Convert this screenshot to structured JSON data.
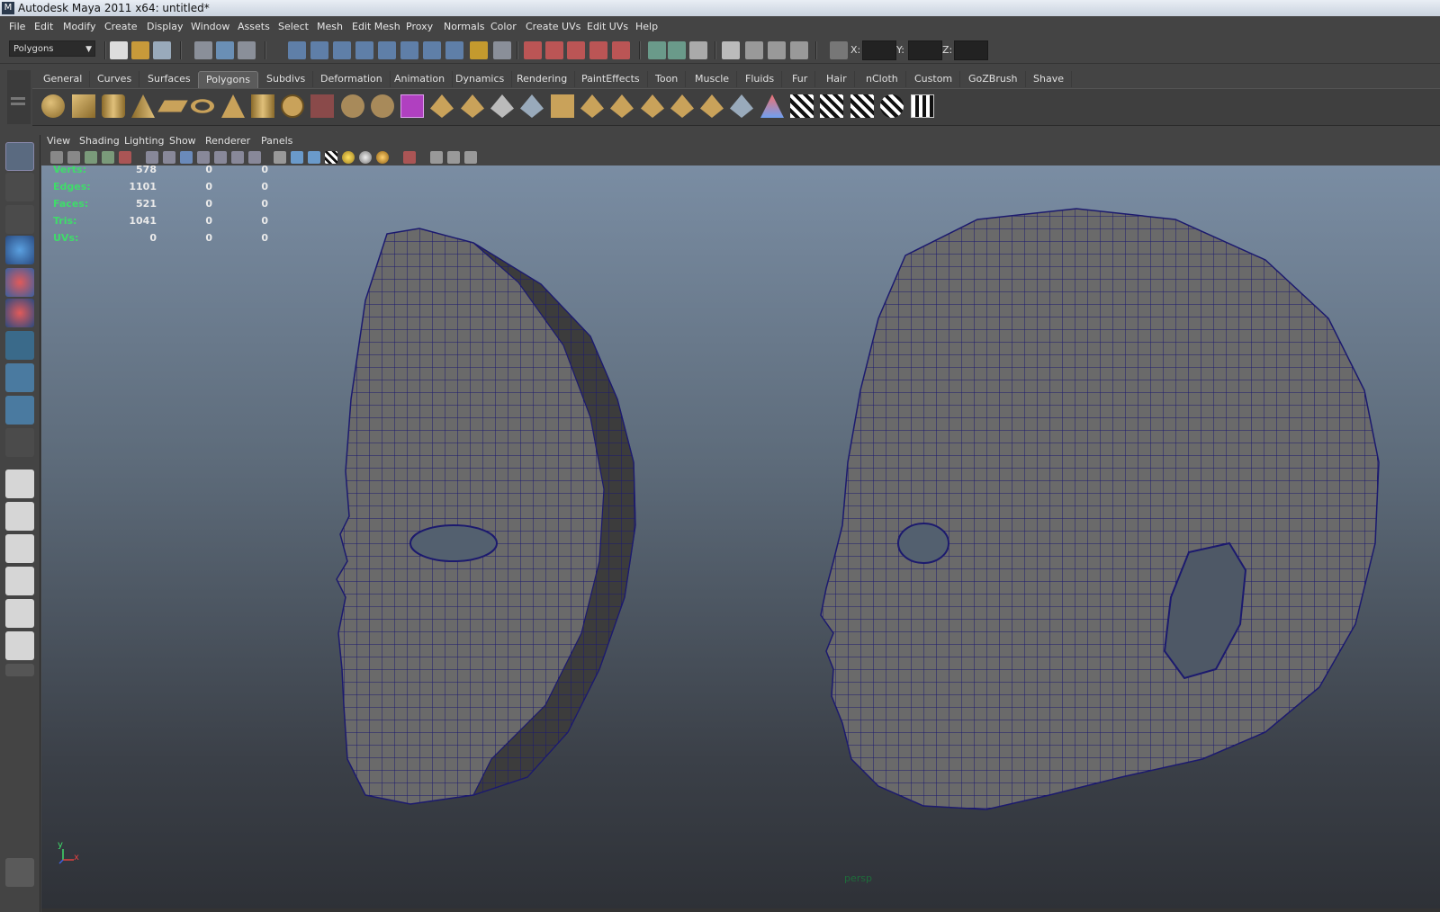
{
  "window": {
    "title": "Autodesk Maya 2011 x64: untitled*"
  },
  "menubar": {
    "items": [
      "File",
      "Edit",
      "Modify",
      "Create",
      "Display",
      "Window",
      "Assets",
      "Select",
      "Mesh",
      "Edit Mesh",
      "Proxy",
      "Normals",
      "Color",
      "Create UVs",
      "Edit UVs",
      "Help"
    ]
  },
  "statusline": {
    "mode": "Polygons",
    "x_label": "X:",
    "y_label": "Y:",
    "z_label": "Z:"
  },
  "shelf": {
    "tabs": [
      "General",
      "Curves",
      "Surfaces",
      "Polygons",
      "Subdivs",
      "Deformation",
      "Animation",
      "Dynamics",
      "Rendering",
      "PaintEffects",
      "Toon",
      "Muscle",
      "Fluids",
      "Fur",
      "Hair",
      "nCloth",
      "Custom",
      "GoZBrush",
      "Shave"
    ],
    "active_tab": "Polygons"
  },
  "panel": {
    "menus": [
      "View",
      "Shading",
      "Lighting",
      "Show",
      "Renderer",
      "Panels"
    ]
  },
  "hud": {
    "rows": [
      {
        "label": "Verts:",
        "values": [
          "578",
          "0",
          "0"
        ]
      },
      {
        "label": "Edges:",
        "values": [
          "1101",
          "0",
          "0"
        ]
      },
      {
        "label": "Faces:",
        "values": [
          "521",
          "0",
          "0"
        ]
      },
      {
        "label": "Tris:",
        "values": [
          "1041",
          "0",
          "0"
        ]
      },
      {
        "label": "UVs:",
        "values": [
          "0",
          "0",
          "0"
        ]
      }
    ]
  },
  "viewport": {
    "camera_label": "persp",
    "axis_y": "y",
    "axis_x": "x"
  },
  "colors": {
    "hud_label": "#3fdc6a",
    "wire": "#1c1a6e",
    "mesh": "#6a6a6a",
    "camera_label": "#1f6b3a"
  }
}
